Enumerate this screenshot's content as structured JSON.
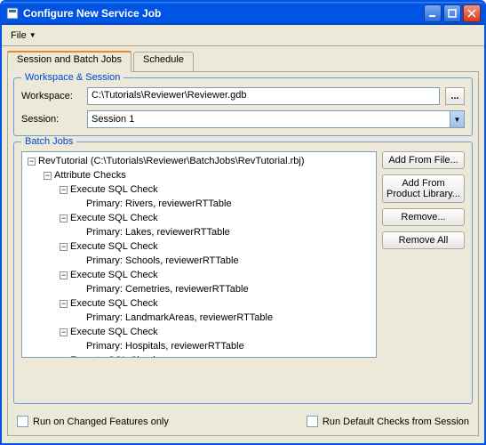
{
  "window_title": "Configure New Service Job",
  "menu": {
    "file": "File"
  },
  "tabs": {
    "session": "Session and Batch Jobs",
    "schedule": "Schedule"
  },
  "workspace_group": {
    "title": "Workspace & Session",
    "workspace_label": "Workspace:",
    "workspace_value": "C:\\Tutorials\\Reviewer\\Reviewer.gdb",
    "browse_label": "...",
    "session_label": "Session:",
    "session_value": "Session 1"
  },
  "batch_group": {
    "title": "Batch Jobs",
    "tree": {
      "root": "RevTutorial (C:\\Tutorials\\Reviewer\\BatchJobs\\RevTutorial.rbj)",
      "attribute_checks": "Attribute Checks",
      "sql_check": "Execute SQL Check",
      "primary_rivers": "Primary: Rivers, reviewerRTTable",
      "primary_lakes": "Primary: Lakes, reviewerRTTable",
      "primary_schools": "Primary: Schools, reviewerRTTable",
      "primary_cemetries": "Primary: Cemetries, reviewerRTTable",
      "primary_landmark": "Primary: LandmarkAreas, reviewerRTTable",
      "primary_hospitals": "Primary: Hospitals, reviewerRTTable"
    },
    "buttons": {
      "add_from_file": "Add From File...",
      "add_from_lib_l1": "Add From",
      "add_from_lib_l2": "Product Library...",
      "remove": "Remove...",
      "remove_all": "Remove All"
    }
  },
  "checks": {
    "changed_only": "Run on Changed Features only",
    "default_checks": "Run Default Checks from Session"
  }
}
